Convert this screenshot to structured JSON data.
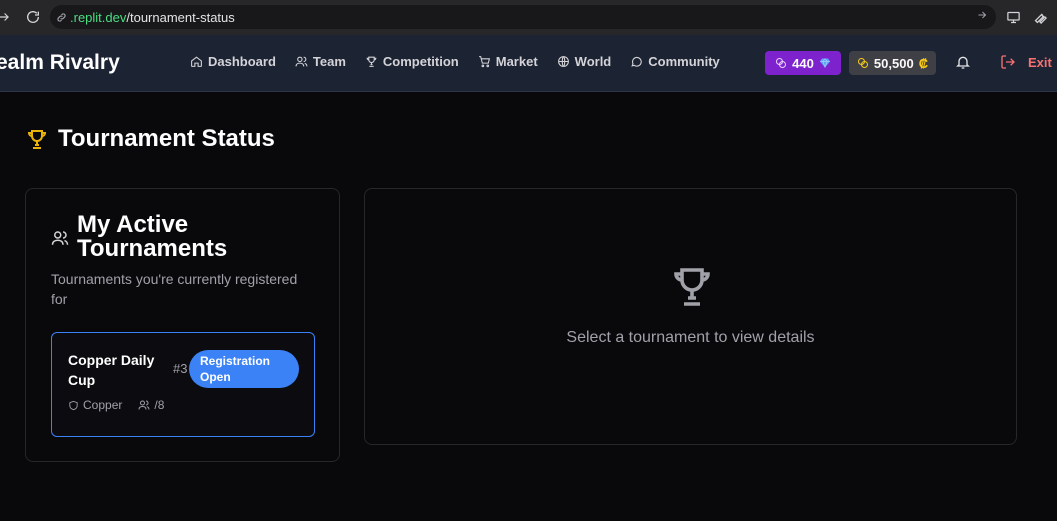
{
  "browser": {
    "url_host": ".replit.dev",
    "url_path": "/tournament-status"
  },
  "header": {
    "brand": "ealm Rivalry",
    "nav": [
      {
        "label": "Dashboard",
        "icon": "home-icon"
      },
      {
        "label": "Team",
        "icon": "users-icon"
      },
      {
        "label": "Competition",
        "icon": "trophy-icon"
      },
      {
        "label": "Market",
        "icon": "cart-icon"
      },
      {
        "label": "World",
        "icon": "globe-icon"
      },
      {
        "label": "Community",
        "icon": "chat-icon"
      }
    ],
    "gems": "440",
    "coins": "50,500",
    "coin_symbol": "₡",
    "exit_label": "Exit"
  },
  "page": {
    "title": "Tournament Status"
  },
  "active_tournaments": {
    "title": "My Active Tournaments",
    "description": "Tournaments you're currently registered for",
    "items": [
      {
        "name": "Copper Daily Cup",
        "number": "#3",
        "status": "Registration Open",
        "division": "Copper",
        "participants": "/8"
      }
    ]
  },
  "details": {
    "empty_text": "Select a tournament to view details"
  },
  "colors": {
    "gems_bg": "#7e22ce",
    "status_badge": "#3b82f6",
    "trophy_accent": "#eab308",
    "exit": "#f87171"
  }
}
